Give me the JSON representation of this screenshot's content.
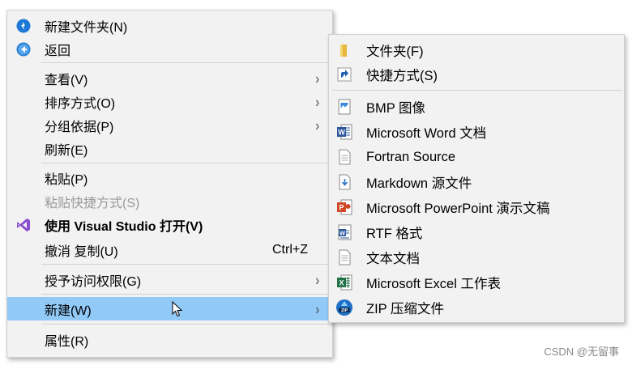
{
  "main_menu": {
    "new_folder": "新建文件夹(N)",
    "back": "返回",
    "view": "查看(V)",
    "sort_by": "排序方式(O)",
    "group_by": "分组依据(P)",
    "refresh": "刷新(E)",
    "paste": "粘贴(P)",
    "paste_shortcut": "粘贴快捷方式(S)",
    "open_vs": "使用 Visual Studio 打开(V)",
    "undo_copy": "撤消 复制(U)",
    "undo_shortcut": "Ctrl+Z",
    "give_access": "授予访问权限(G)",
    "new": "新建(W)",
    "properties": "属性(R)",
    "submenu_arrow": "›"
  },
  "sub_menu": {
    "folder": "文件夹(F)",
    "shortcut": "快捷方式(S)",
    "bmp": "BMP 图像",
    "word": "Microsoft Word 文档",
    "fortran": "Fortran Source",
    "markdown": "Markdown 源文件",
    "powerpoint": "Microsoft PowerPoint 演示文稿",
    "rtf": "RTF 格式",
    "text": "文本文档",
    "excel": "Microsoft Excel 工作表",
    "zip": "ZIP 压缩文件"
  },
  "watermark": "CSDN @无留事",
  "colors": {
    "menu_bg": "#f2f2f2",
    "highlight": "#91c9f7",
    "separator": "#d2d2d2",
    "disabled_text": "#9a9a9a"
  }
}
